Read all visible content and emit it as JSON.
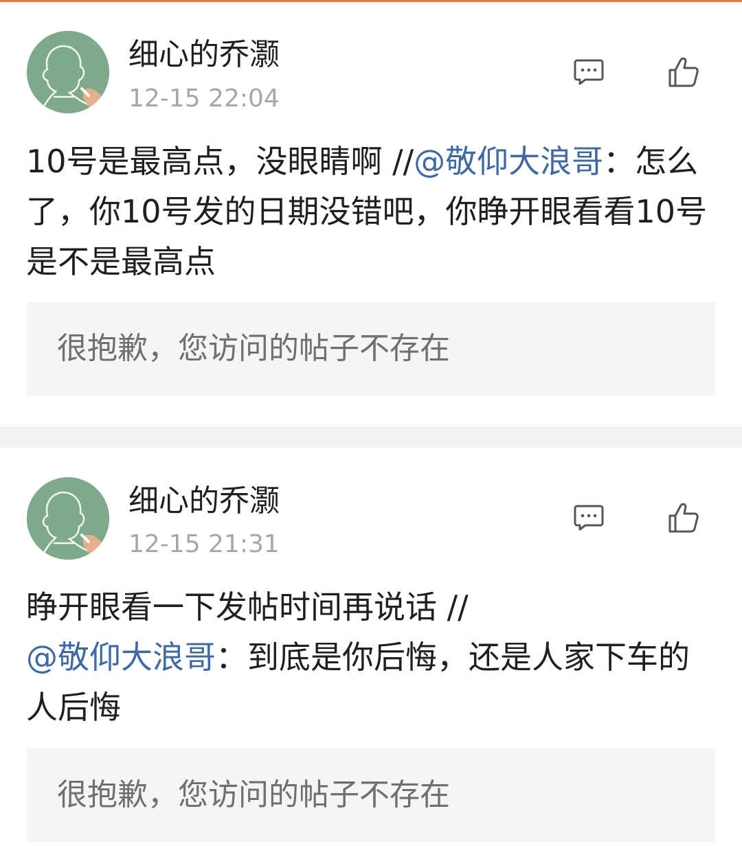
{
  "posts": [
    {
      "username": "细心的乔灏",
      "time": "12-15 22:04",
      "text_before": "10号是最高点，没眼睛啊 //",
      "mention": "@敬仰大浪哥",
      "text_after": "：怎么了，你10号发的日期没错吧，你睁开眼看看10号是不是最高点",
      "quote": "很抱歉，您访问的帖子不存在"
    },
    {
      "username": "细心的乔灏",
      "time": "12-15 21:31",
      "text_before": "睁开眼看一下发帖时间再说话 //",
      "mention": "@敬仰大浪哥",
      "text_after": "：到底是你后悔，还是人家下车的人后悔",
      "quote": "很抱歉，您访问的帖子不存在"
    }
  ],
  "icons": {
    "comment": "comment-icon",
    "like": "thumbs-up-icon",
    "avatar": "chalkboard-silhouette-avatar"
  },
  "colors": {
    "accent": "#ef7a3a",
    "mention": "#3f69a5",
    "muted": "#a7a7a7",
    "quote_bg": "#f5f5f5",
    "avatar_bg": "#7ea98a"
  }
}
